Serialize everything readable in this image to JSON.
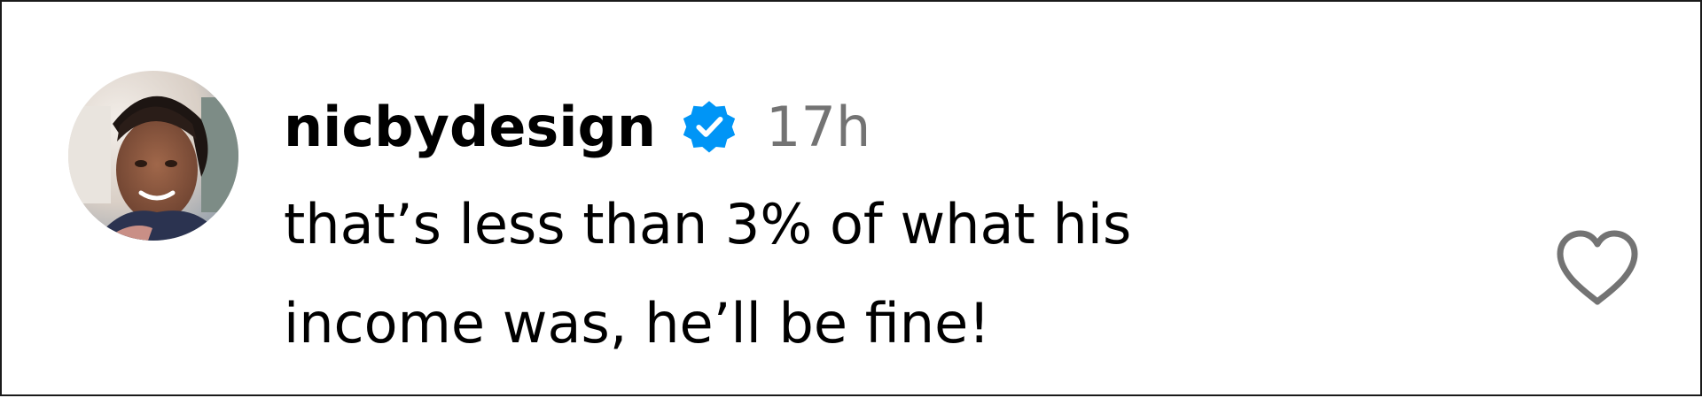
{
  "comment": {
    "username": "nicbydesign",
    "verified": true,
    "timestamp": "17h",
    "text": "that’s less than 3% of what his income was, he’ll be fine!",
    "liked": false
  },
  "icons": {
    "avatar": "profile-photo",
    "verified": "verified-badge-icon",
    "like": "heart-outline-icon"
  },
  "colors": {
    "username": "#000000",
    "timestamp": "#737373",
    "verified_badge": "#0095F6",
    "like_icon": "#737373",
    "frame_border": "#1A1A1A"
  }
}
